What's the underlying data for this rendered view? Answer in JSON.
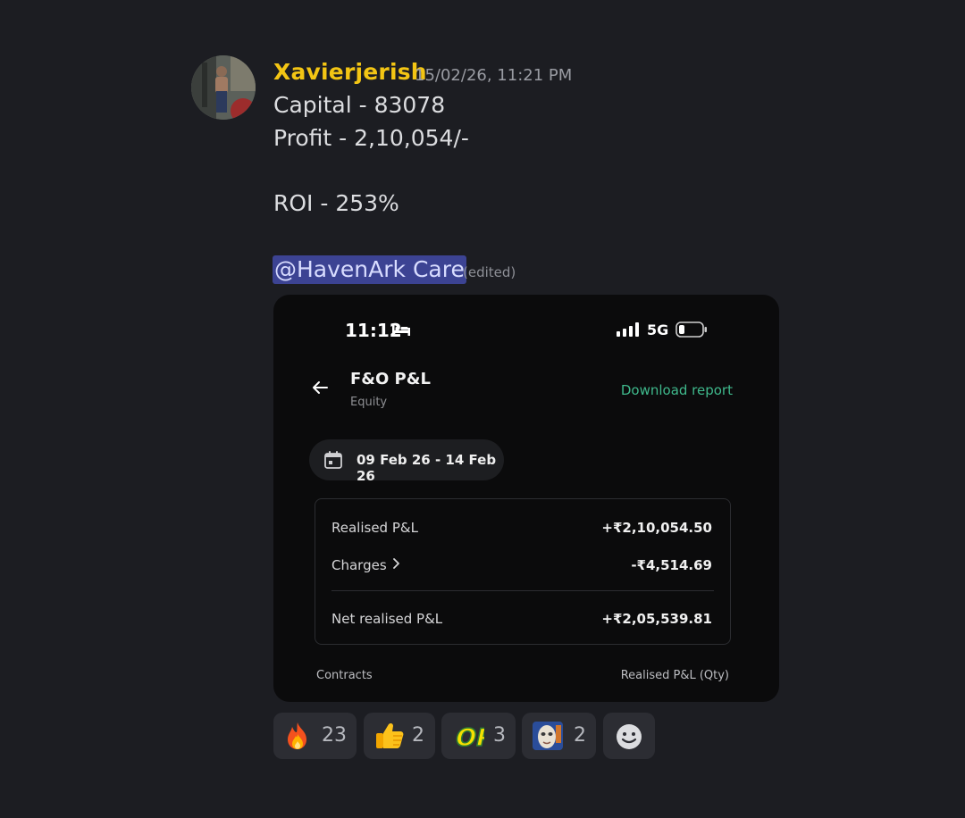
{
  "message": {
    "username": "Xavierjerish",
    "timestamp": "15/02/26, 11:21 PM",
    "lines": [
      "Capital - 83078",
      "Profit - 2,10,054/-",
      "ROI - 253%"
    ],
    "mention": "@HavenArk Care",
    "edited": "(edited)",
    "username_color": "#f3c514",
    "mention_bg": "#3c4393"
  },
  "screenshot": {
    "status_time": "11:12",
    "network": "5G",
    "title": "F&O P&L",
    "subtitle": "Equity",
    "download_label": "Download report",
    "date_range": "09 Feb 26 - 14 Feb 26",
    "rows": [
      {
        "label": "Realised P&L",
        "value": "+₹2,10,054.50"
      },
      {
        "label": "Charges",
        "value": "-₹4,514.69"
      },
      {
        "label": "Net realised P&L",
        "value": "+₹2,05,539.81"
      }
    ],
    "footer_left": "Contracts",
    "footer_right": "Realised P&L (Qty)",
    "accent_green": "#3fb98c"
  },
  "reactions": [
    {
      "icon": "fire-emoji",
      "count": "23"
    },
    {
      "icon": "thumbs-up-emoji",
      "count": "2"
    },
    {
      "icon": "op-emoji",
      "count": "3"
    },
    {
      "icon": "custom-face-emoji",
      "count": "2"
    },
    {
      "icon": "add-reaction-icon"
    }
  ]
}
